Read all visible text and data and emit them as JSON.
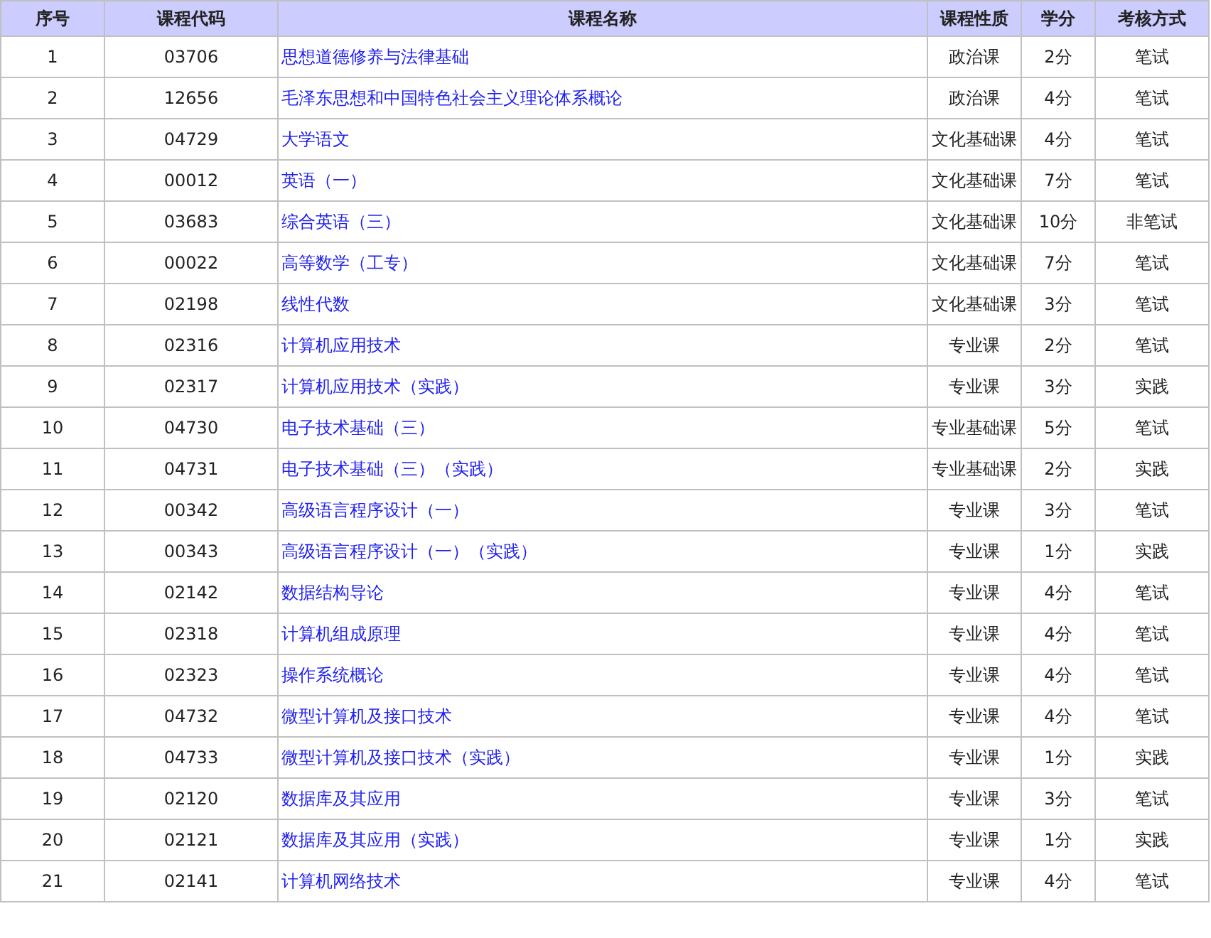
{
  "table": {
    "columns": [
      "序号",
      "课程代码",
      "课程名称",
      "课程性质",
      "学分",
      "考核方式"
    ],
    "rows": [
      [
        "1",
        "03706",
        "思想道德修养与法律基础",
        "政治课",
        "2分",
        "笔试"
      ],
      [
        "2",
        "12656",
        "毛泽东思想和中国特色社会主义理论体系概论",
        "政治课",
        "4分",
        "笔试"
      ],
      [
        "3",
        "04729",
        "大学语文",
        "文化基础课",
        "4分",
        "笔试"
      ],
      [
        "4",
        "00012",
        "英语（一）",
        "文化基础课",
        "7分",
        "笔试"
      ],
      [
        "5",
        "03683",
        "综合英语（三）",
        "文化基础课",
        "10分",
        "非笔试"
      ],
      [
        "6",
        "00022",
        "高等数学（工专）",
        "文化基础课",
        "7分",
        "笔试"
      ],
      [
        "7",
        "02198",
        "线性代数",
        "文化基础课",
        "3分",
        "笔试"
      ],
      [
        "8",
        "02316",
        "计算机应用技术",
        "专业课",
        "2分",
        "笔试"
      ],
      [
        "9",
        "02317",
        "计算机应用技术（实践）",
        "专业课",
        "3分",
        "实践"
      ],
      [
        "10",
        "04730",
        "电子技术基础（三）",
        "专业基础课",
        "5分",
        "笔试"
      ],
      [
        "11",
        "04731",
        "电子技术基础（三）（实践）",
        "专业基础课",
        "2分",
        "实践"
      ],
      [
        "12",
        "00342",
        "高级语言程序设计（一）",
        "专业课",
        "3分",
        "笔试"
      ],
      [
        "13",
        "00343",
        "高级语言程序设计（一）（实践）",
        "专业课",
        "1分",
        "实践"
      ],
      [
        "14",
        "02142",
        "数据结构导论",
        "专业课",
        "4分",
        "笔试"
      ],
      [
        "15",
        "02318",
        "计算机组成原理",
        "专业课",
        "4分",
        "笔试"
      ],
      [
        "16",
        "02323",
        "操作系统概论",
        "专业课",
        "4分",
        "笔试"
      ],
      [
        "17",
        "04732",
        "微型计算机及接口技术",
        "专业课",
        "4分",
        "笔试"
      ],
      [
        "18",
        "04733",
        "微型计算机及接口技术（实践）",
        "专业课",
        "1分",
        "实践"
      ],
      [
        "19",
        "02120",
        "数据库及其应用",
        "专业课",
        "3分",
        "笔试"
      ],
      [
        "20",
        "02121",
        "数据库及其应用（实践）",
        "专业课",
        "1分",
        "实践"
      ],
      [
        "21",
        "02141",
        "计算机网络技术",
        "专业课",
        "4分",
        "笔试"
      ]
    ]
  }
}
